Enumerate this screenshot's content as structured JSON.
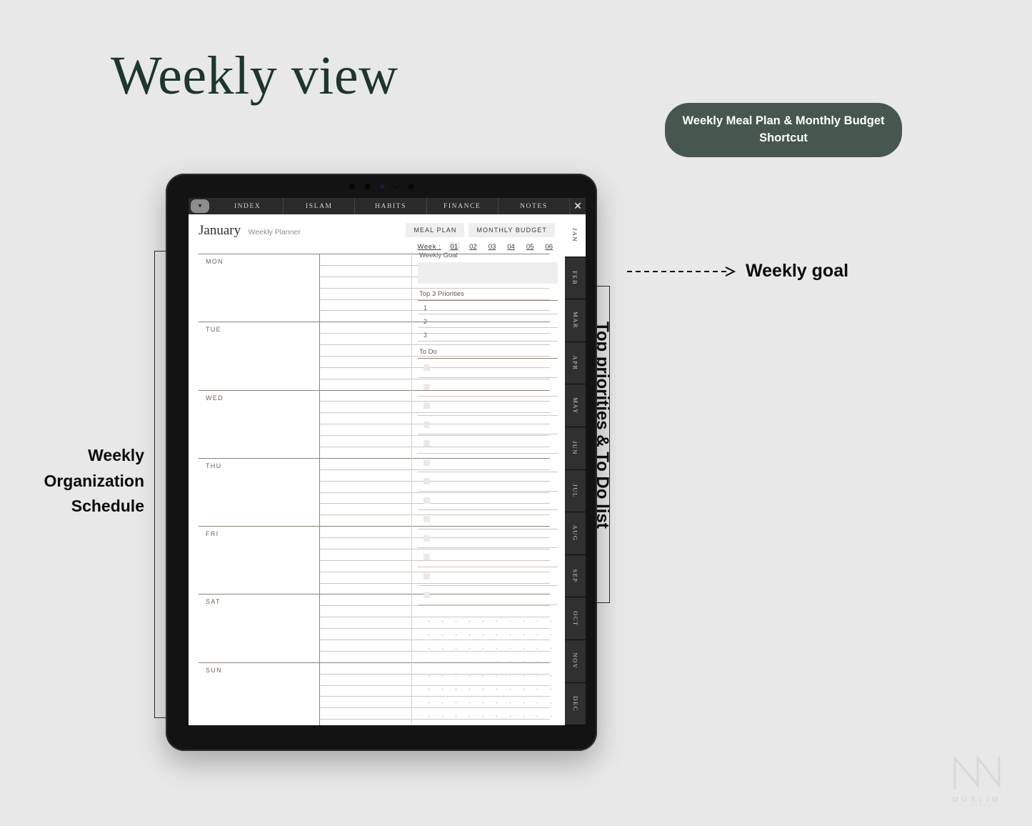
{
  "headline": "Weekly view",
  "badge": {
    "text": "Weekly Meal Plan  &  Monthly Budget Shortcut"
  },
  "annotations": {
    "left": "Weekly Organization Schedule",
    "goal": "Weekly goal",
    "priorities": "Top priorities & To Do list"
  },
  "device": {
    "nav": {
      "chevron_icon": "chevron-down-icon",
      "close_icon": "close-icon",
      "tabs": [
        {
          "label": "INDEX"
        },
        {
          "label": "ISLAM"
        },
        {
          "label": "HABITS"
        },
        {
          "label": "FINANCE"
        },
        {
          "label": "NOTES"
        }
      ]
    },
    "header": {
      "month": "January",
      "subtitle": "Weekly Planner",
      "shortcuts": [
        {
          "label": "MEAL PLAN"
        },
        {
          "label": "MONTHLY BUDGET"
        }
      ],
      "week_label": "Week :",
      "weeks": [
        "01",
        "02",
        "03",
        "04",
        "05",
        "06"
      ],
      "active_week": "01"
    },
    "schedule": {
      "days": [
        {
          "name": "MON"
        },
        {
          "name": "TUE"
        },
        {
          "name": "WED"
        },
        {
          "name": "THU"
        },
        {
          "name": "FRI"
        },
        {
          "name": "SAT"
        },
        {
          "name": "SUN"
        }
      ],
      "lines_per_day": 5
    },
    "pane": {
      "goal_label": "Weekly Goal",
      "goal_value": "",
      "priorities_label": "Top 3 Priorities",
      "priorities": [
        "1",
        "2",
        "3"
      ],
      "todo_label": "To Do",
      "todo_rows": 13
    },
    "months": [
      {
        "label": "JAN",
        "active": true
      },
      {
        "label": "FEB",
        "active": false
      },
      {
        "label": "MAR",
        "active": false
      },
      {
        "label": "APR",
        "active": false
      },
      {
        "label": "MAY",
        "active": false
      },
      {
        "label": "JUN",
        "active": false
      },
      {
        "label": "JUL",
        "active": false
      },
      {
        "label": "AUG",
        "active": false
      },
      {
        "label": "SEP",
        "active": false
      },
      {
        "label": "OCT",
        "active": false
      },
      {
        "label": "NOV",
        "active": false
      },
      {
        "label": "DEC",
        "active": false
      }
    ]
  },
  "watermark": {
    "name": "MUSLIM",
    "sub": "PLANNER"
  },
  "colors": {
    "background": "#e8e8e8",
    "headline": "#1e3530",
    "badge": "#47564f",
    "rule": "#8b8278",
    "device": "#131313"
  }
}
